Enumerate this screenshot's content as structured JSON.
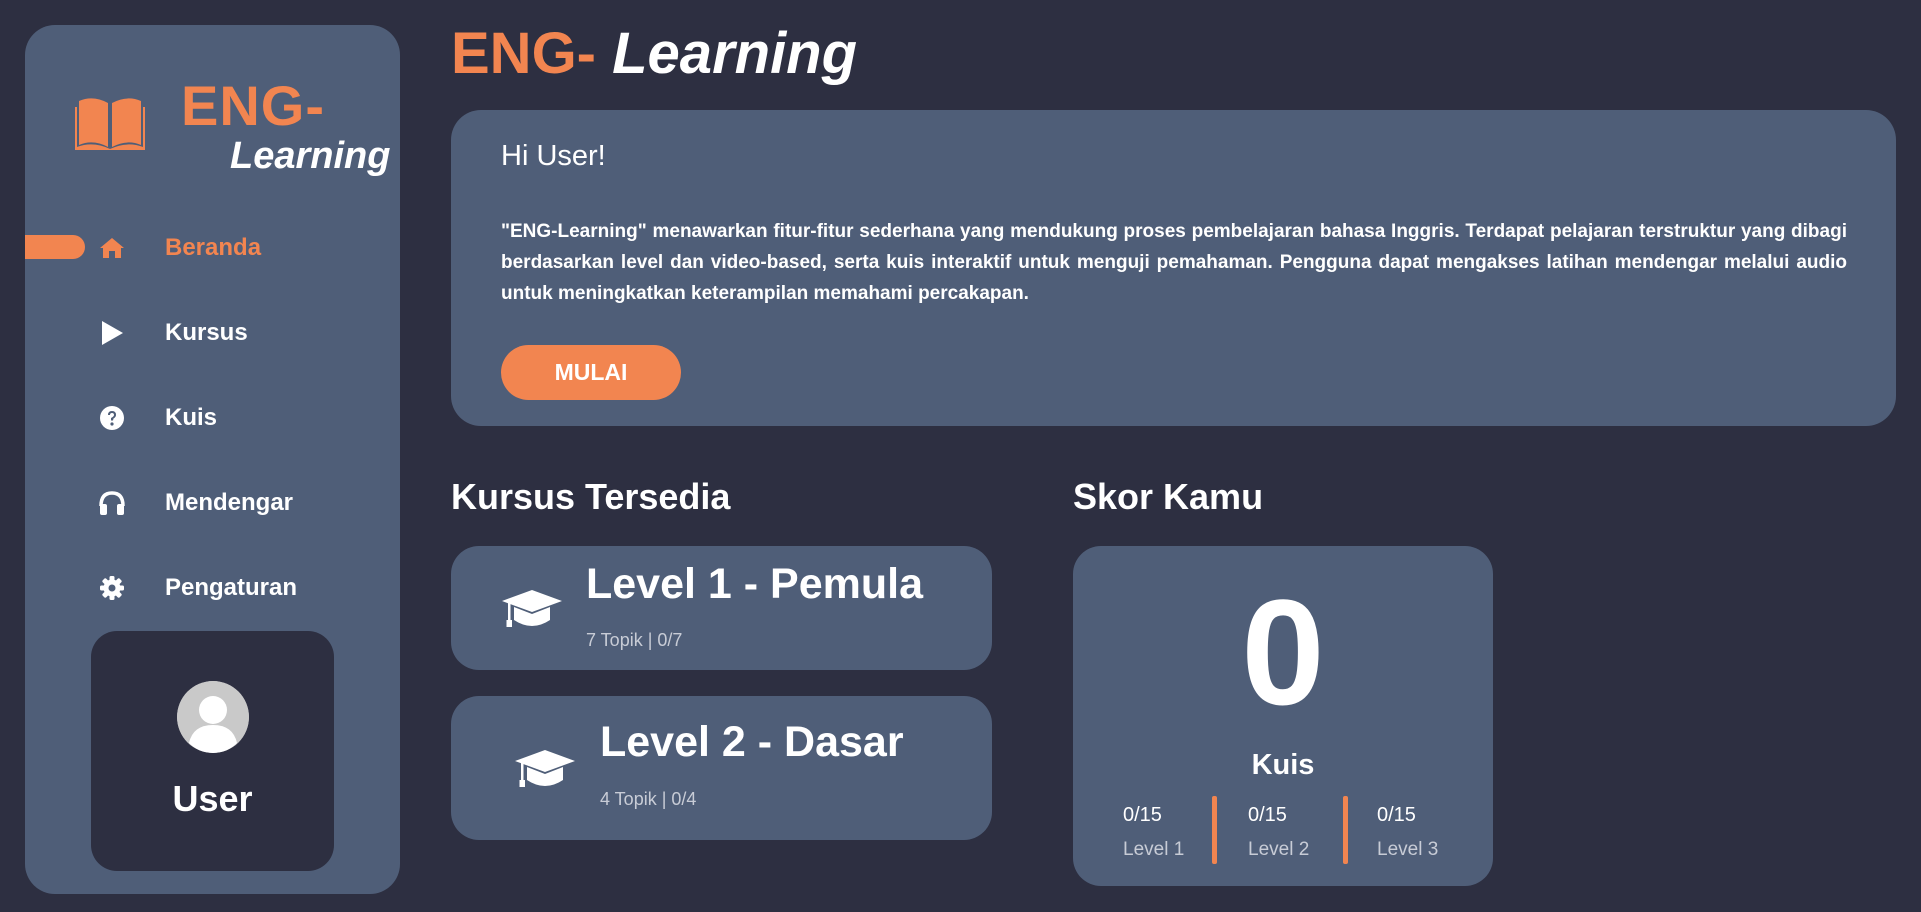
{
  "app": {
    "logo_top": "ENG-",
    "logo_bottom": "Learning",
    "title_part1": "ENG-",
    "title_part2": "Learning"
  },
  "colors": {
    "accent": "#f28550",
    "background": "#2d2f41",
    "card": "#4f5e78",
    "muted_text": "#c8ccd6"
  },
  "sidebar": {
    "items": [
      {
        "label": "Beranda",
        "icon": "home-icon",
        "active": true
      },
      {
        "label": "Kursus",
        "icon": "play-icon",
        "active": false
      },
      {
        "label": "Kuis",
        "icon": "question-circle-icon",
        "active": false
      },
      {
        "label": "Mendengar",
        "icon": "headphones-icon",
        "active": false
      },
      {
        "label": "Pengaturan",
        "icon": "gear-icon",
        "active": false
      }
    ],
    "user": {
      "name": "User",
      "icon": "avatar-icon"
    }
  },
  "hero": {
    "greeting": "Hi User!",
    "description": "\"ENG-Learning\" menawarkan fitur-fitur sederhana yang mendukung proses pembelajaran bahasa Inggris. Terdapat pelajaran terstruktur yang dibagi berdasarkan level dan video-based, serta kuis interaktif untuk menguji pemahaman. Pengguna dapat mengakses latihan mendengar melalui audio untuk meningkatkan keterampilan memahami percakapan.",
    "button_label": "MULAI"
  },
  "courses": {
    "heading": "Kursus Tersedia",
    "items": [
      {
        "title": "Level 1 - Pemula",
        "meta": "7 Topik | 0/7",
        "icon": "graduation-cap-icon"
      },
      {
        "title": "Level 2 - Dasar",
        "meta": "4 Topik | 0/4",
        "icon": "graduation-cap-icon"
      }
    ]
  },
  "score": {
    "heading": "Skor Kamu",
    "value": "0",
    "label": "Kuis",
    "levels": [
      {
        "score": "0/15",
        "name": "Level 1"
      },
      {
        "score": "0/15",
        "name": "Level 2"
      },
      {
        "score": "0/15",
        "name": "Level 3"
      }
    ]
  }
}
